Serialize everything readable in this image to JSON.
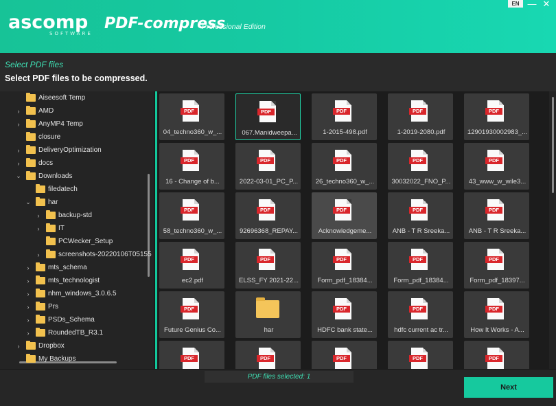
{
  "header": {
    "logo_text": "ascomp",
    "logo_sub": "SOFTWARE",
    "app_name": "PDF-compress",
    "edition": "Professional Edition",
    "lang": "EN",
    "minimize_glyph": "—",
    "close_glyph": "✕"
  },
  "step": {
    "label": "Select PDF files",
    "description": "Select PDF files to be compressed."
  },
  "tree": [
    {
      "label": "Aiseesoft Temp",
      "indent": 0,
      "expand": ""
    },
    {
      "label": "AMD",
      "indent": 0,
      "expand": "›"
    },
    {
      "label": "AnyMP4 Temp",
      "indent": 0,
      "expand": "›"
    },
    {
      "label": "closure",
      "indent": 0,
      "expand": ""
    },
    {
      "label": "DeliveryOptimization",
      "indent": 0,
      "expand": "›"
    },
    {
      "label": "docs",
      "indent": 0,
      "expand": "›"
    },
    {
      "label": "Downloads",
      "indent": 0,
      "expand": "⌄"
    },
    {
      "label": "filedatech",
      "indent": 1,
      "expand": ""
    },
    {
      "label": "har",
      "indent": 1,
      "expand": "⌄"
    },
    {
      "label": "backup-std",
      "indent": 2,
      "expand": "›"
    },
    {
      "label": "IT",
      "indent": 2,
      "expand": "›"
    },
    {
      "label": "PCWecker_Setup",
      "indent": 2,
      "expand": ""
    },
    {
      "label": "screenshots-20220106T05155",
      "indent": 2,
      "expand": "›"
    },
    {
      "label": "mts_schema",
      "indent": 1,
      "expand": "›"
    },
    {
      "label": "mts_technologist",
      "indent": 1,
      "expand": "›"
    },
    {
      "label": "nhm_windows_3.0.6.5",
      "indent": 1,
      "expand": "›"
    },
    {
      "label": "Prs",
      "indent": 1,
      "expand": "›"
    },
    {
      "label": "PSDs_Schema",
      "indent": 1,
      "expand": "›"
    },
    {
      "label": "RoundedTB_R3.1",
      "indent": 1,
      "expand": "›"
    },
    {
      "label": "Dropbox",
      "indent": 0,
      "expand": "›"
    },
    {
      "label": "My Backups",
      "indent": 0,
      "expand": ""
    }
  ],
  "files": [
    {
      "name": "04_techno360_w_...",
      "type": "pdf"
    },
    {
      "name": "067.Manidweepa...",
      "type": "pdf",
      "selected": true
    },
    {
      "name": "1-2015-498.pdf",
      "type": "pdf"
    },
    {
      "name": "1-2019-2080.pdf",
      "type": "pdf"
    },
    {
      "name": "12901930002983_...",
      "type": "pdf"
    },
    {
      "name": "16 - Change of b...",
      "type": "pdf"
    },
    {
      "name": "2022-03-01_PC_P...",
      "type": "pdf"
    },
    {
      "name": "26_techno360_w_...",
      "type": "pdf"
    },
    {
      "name": "30032022_FNO_P...",
      "type": "pdf"
    },
    {
      "name": "43_www_w_wile3...",
      "type": "pdf"
    },
    {
      "name": "58_techno360_w_...",
      "type": "pdf"
    },
    {
      "name": "92696368_REPAY...",
      "type": "pdf"
    },
    {
      "name": "Acknowledgeme...",
      "type": "pdf",
      "hover": true
    },
    {
      "name": "ANB - T R Sreeka...",
      "type": "pdf"
    },
    {
      "name": "ANB - T R Sreeka...",
      "type": "pdf"
    },
    {
      "name": "ec2.pdf",
      "type": "pdf"
    },
    {
      "name": "ELSS_FY 2021-22...",
      "type": "pdf"
    },
    {
      "name": "Form_pdf_18384...",
      "type": "pdf"
    },
    {
      "name": "Form_pdf_18384...",
      "type": "pdf"
    },
    {
      "name": "Form_pdf_18397...",
      "type": "pdf"
    },
    {
      "name": "Future Genius Co...",
      "type": "pdf"
    },
    {
      "name": "har",
      "type": "folder"
    },
    {
      "name": "HDFC bank state...",
      "type": "pdf"
    },
    {
      "name": "hdfc current ac tr...",
      "type": "pdf"
    },
    {
      "name": "How It Works - A...",
      "type": "pdf"
    },
    {
      "name": "",
      "type": "pdf"
    },
    {
      "name": "",
      "type": "pdf"
    },
    {
      "name": "",
      "type": "pdf"
    },
    {
      "name": "",
      "type": "pdf"
    },
    {
      "name": "",
      "type": "pdf"
    }
  ],
  "pdf_tag": "PDF",
  "footer": {
    "status": "PDF files selected: 1",
    "next_label": "Next"
  },
  "colors": {
    "accent": "#16c99e",
    "pdf_red": "#d9262b",
    "folder_yellow": "#f2c14e"
  }
}
